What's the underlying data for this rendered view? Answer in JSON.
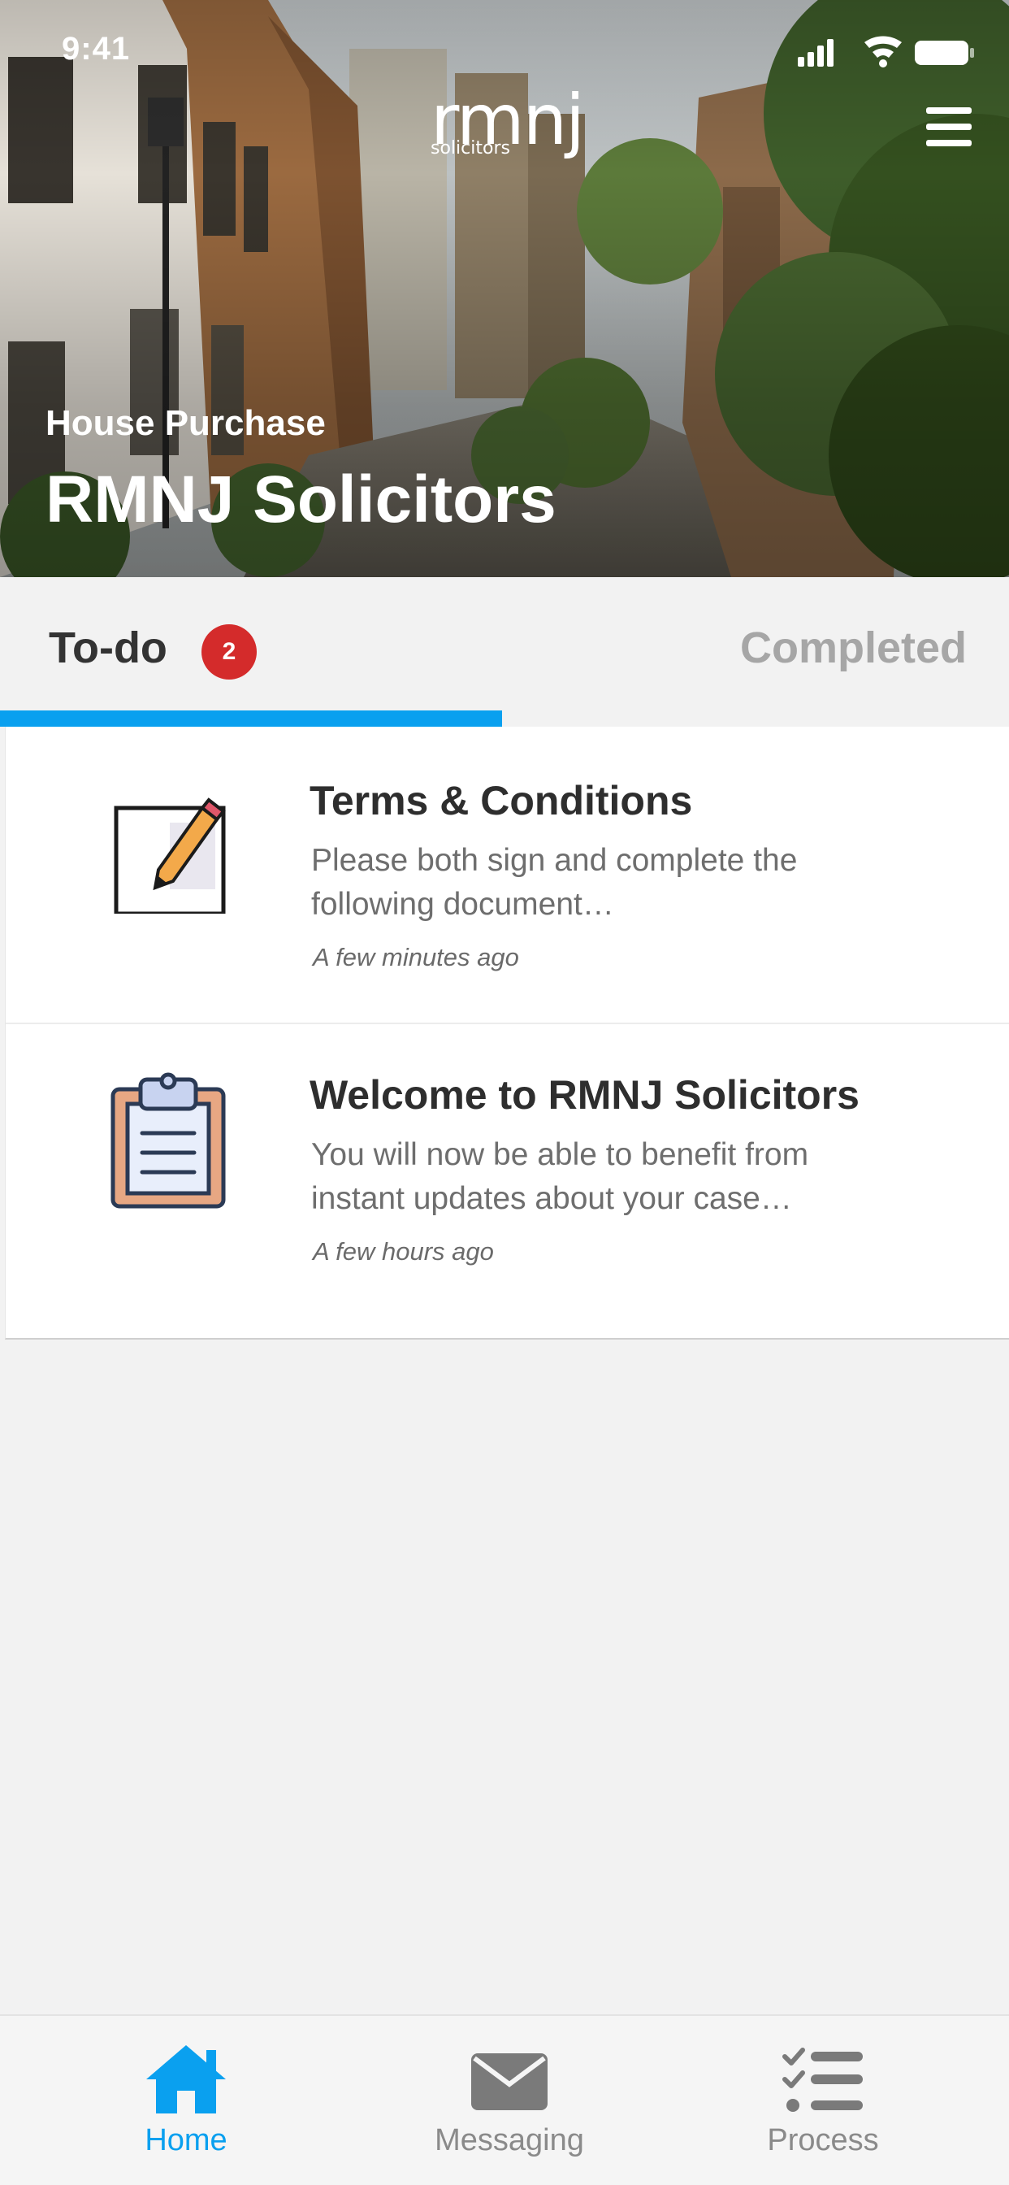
{
  "status_bar": {
    "time": "9:41",
    "icons": [
      "signal-icon",
      "wifi-icon",
      "battery-icon"
    ]
  },
  "header": {
    "brand_word": "rmnj",
    "brand_sub": "solicitors",
    "case_type": "House Purchase",
    "case_title": "RMNJ Solicitors",
    "menu_icon": "hamburger-menu-icon"
  },
  "tabs": {
    "todo_label": "To-do",
    "todo_count": "2",
    "completed_label": "Completed",
    "active": "To-do"
  },
  "items": [
    {
      "title": "Terms & Conditions",
      "description": "Please both sign and complete the following document…",
      "time": "A few minutes ago",
      "icon": "document-sign-icon"
    },
    {
      "title": "Welcome to RMNJ Solicitors",
      "description": "You will now be able to benefit from instant updates about your case…",
      "time": "A few hours ago",
      "icon": "clipboard-icon"
    }
  ],
  "bottom_nav": {
    "home_label": "Home",
    "messaging_label": "Messaging",
    "process_label": "Process",
    "active": "Home"
  },
  "colors": {
    "accent": "#0aa0ef",
    "badge": "#d42b2b",
    "inactive": "#8a8a8a"
  }
}
